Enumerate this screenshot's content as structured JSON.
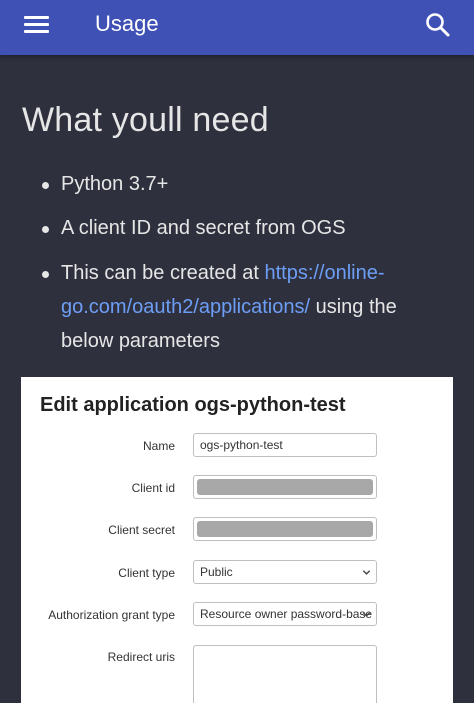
{
  "topbar": {
    "title": "Usage",
    "menu_icon": "hamburger-menu-icon",
    "search_icon": "search-icon"
  },
  "main": {
    "heading": "What youll need",
    "bullets": [
      {
        "text": "Python 3.7+"
      },
      {
        "text": "A client ID and secret from OGS"
      },
      {
        "text_before": "This can be created at ",
        "link_text": "https://online-go.com/oauth2/applications/",
        "text_after": " using the below parameters"
      }
    ]
  },
  "screenshot": {
    "title": "Edit application ogs-python-test",
    "fields": {
      "name": {
        "label": "Name",
        "value": "ogs-python-test"
      },
      "client_id": {
        "label": "Client id",
        "value": ""
      },
      "client_secret": {
        "label": "Client secret",
        "value": ""
      },
      "client_type": {
        "label": "Client type",
        "value": "Public"
      },
      "grant_type": {
        "label": "Authorization grant type",
        "value": "Resource owner password-base"
      },
      "redirect_uris": {
        "label": "Redirect uris",
        "value": ""
      }
    }
  },
  "colors": {
    "topbar": "#3f51b5",
    "background": "#2e303e",
    "link": "#6d9ef5",
    "text": "#e6e6e6"
  }
}
